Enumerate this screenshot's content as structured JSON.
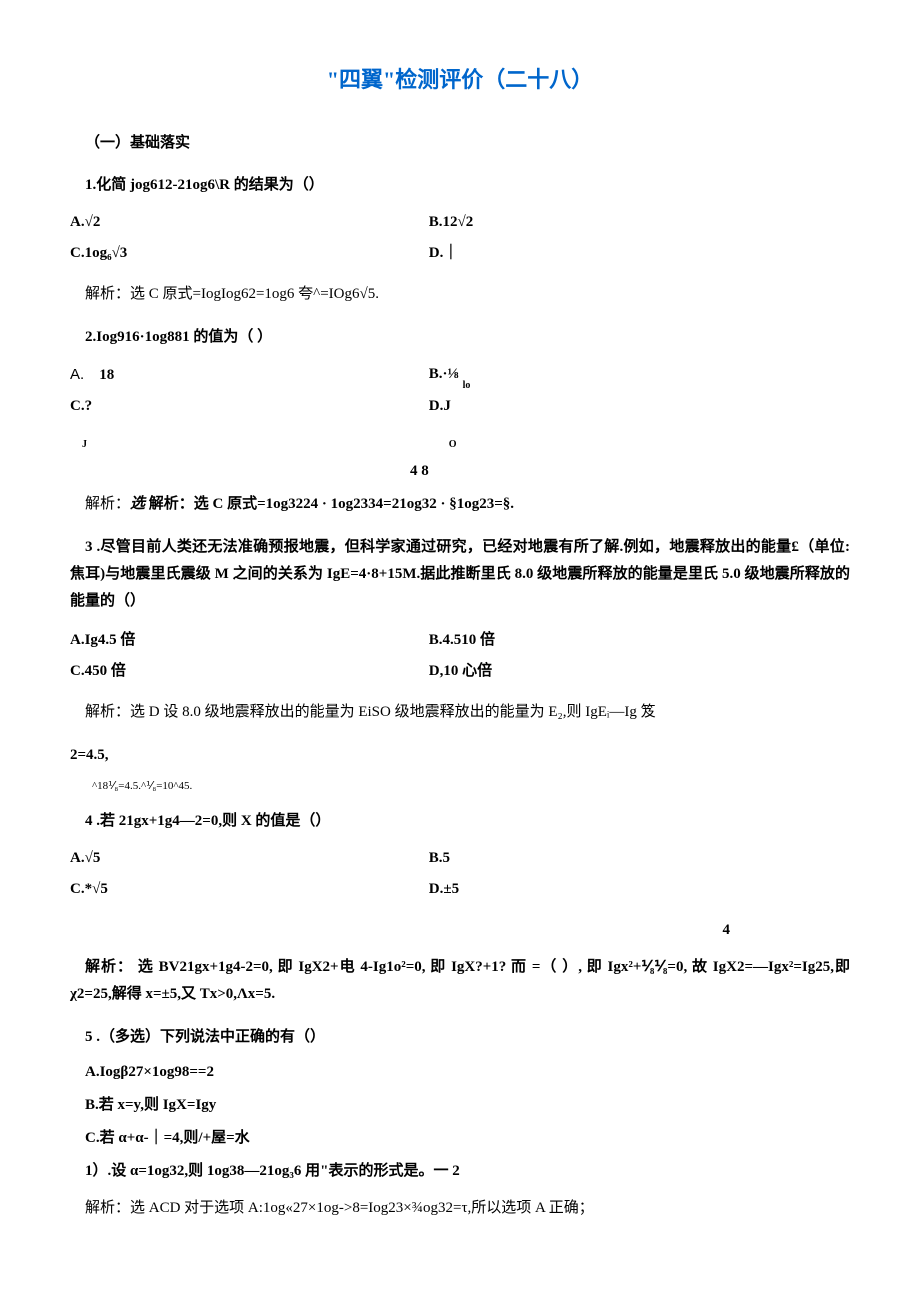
{
  "title": "\"四翼\"检测评价（二十八）",
  "section1": "（一）基础落实",
  "q1": {
    "stem": "1.化简 jog612-21og6\\R 的结果为（）",
    "A": "A.√2",
    "B": "B.12√2",
    "C": "C.1og₆√3",
    "D": "D.｜",
    "explain_pre": "解析：选 C 原式=IogIog62=1og6 夸^=IOg6√5."
  },
  "q2": {
    "stem": "2.Iog916·1og881 的值为（      ）",
    "A_label": "A.",
    "A_val": "18",
    "B": "B.·⅛",
    "B_sub": "lo",
    "C": "C.?",
    "C_sub": "J",
    "D": "D.J",
    "D_sub": "O",
    "nums_48": "4            8",
    "explain": "解析：选 C 原式=1og3224 · 1og2334=21og32 · §1og23=§."
  },
  "q3": {
    "stem1": "3 .尽管目前人类还无法准确预报地震，但科学家通过研究，已经对地震有所了解.例如，地震释放出的能量£（单位: 焦耳)与地震里氏震级 M 之间的关系为 IgE=4·8+15M.据此推断里氏 8.0 级地震所释放的能量是里氏 5.0 级地震所释放的能量的（）",
    "A": "A.Ig4.5 倍",
    "B": "B.4.510 倍",
    "C": "C.450 倍",
    "D": "D,10 心倍",
    "explain1": "解析：选 D 设 8.0 级地震释放出的能量为 EiSO 级地震释放出的能量为 E₂,则 IgEᵢ—Ig 笈",
    "explain2": "2=4.5,",
    "small": "^18⅟₈=4.5.^⅟₈=10^45."
  },
  "q4": {
    "stem": "4      .若 21gx+1g4—2=0,则 X 的值是（）",
    "A": "A.√5",
    "B": "B.5",
    "C": "C.*√5",
    "D": "D.±5",
    "topnum": "4",
    "explain": "解析： 选 BV21gx+1g4-2=0, 即 IgX2+电 4-Ig1o²=0, 即 IgX?+1? 而 =（ ）, 即 Igx²+⅟₈⅟₈=0, 故 IgX2=—Igx²=Ig25,即 χ2=25,解得 x=±5,又 Tx>0,Λx=5."
  },
  "q5": {
    "stem": "5      .（多选）下列说法中正确的有（）",
    "A": "A.Iogβ27×1og98==2",
    "B": "B.若 x=y,则 IgX=Igy",
    "C": "C.若 α+α-｜=4,则/+屋=水",
    "D": "1）.设 α=1og32,则 1og38—21og₃6 用\"表示的形式是。一 2",
    "explain": "解析：选 ACD 对于选项 A:1og«27×1og->8=Iog23×¾og32=τ,所以选项 A 正确；"
  }
}
